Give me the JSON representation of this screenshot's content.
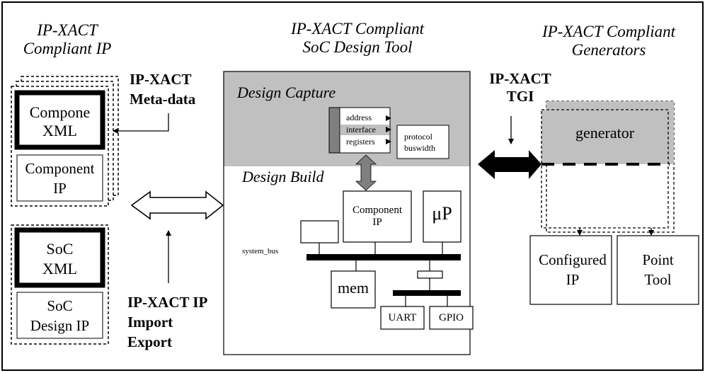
{
  "headings": {
    "ip_line1": "IP-XACT",
    "ip_line2": "Compliant IP",
    "tool_line1": "IP-XACT Compliant",
    "tool_line2": "SoC Design Tool",
    "gen_line1": "IP-XACT Compliant",
    "gen_line2": "Generators"
  },
  "labels": {
    "meta_line1": "IP-XACT",
    "meta_line2": "Meta-data",
    "import_line1": "IP-XACT IP",
    "import_line2": "Import",
    "import_line3": "Export",
    "tgi_line1": "IP-XACT",
    "tgi_line2": "TGI"
  },
  "component": {
    "xml_line1": "Compone",
    "xml_line2": "XML",
    "ip_line1": "Component",
    "ip_line2": "IP"
  },
  "soc": {
    "xml_line1": "SoC",
    "xml_line2": "XML",
    "ip_line1": "SoC",
    "ip_line2": "Design IP"
  },
  "design_capture": {
    "title": "Design Capture",
    "menu": [
      "address",
      "interface",
      "registers"
    ],
    "selected_item": "interface",
    "submenu": [
      "protocol",
      "buswidth"
    ]
  },
  "design_build": {
    "title": "Design Build",
    "component_line1": "Component",
    "component_line2": "IP",
    "up": "μP",
    "bus_label": "system_bus",
    "mem": "mem",
    "uart": "UART",
    "gpio": "GPIO"
  },
  "generators": {
    "generator": "generator",
    "configured_line1": "Configured",
    "configured_line2": "IP",
    "point_line1": "Point",
    "point_line2": "Tool"
  },
  "colors": {
    "panel_gray": "#c0c0c0",
    "menu_bar_gray": "#808080",
    "arrow_gray": "#7f7f7f",
    "line": "#000000"
  }
}
